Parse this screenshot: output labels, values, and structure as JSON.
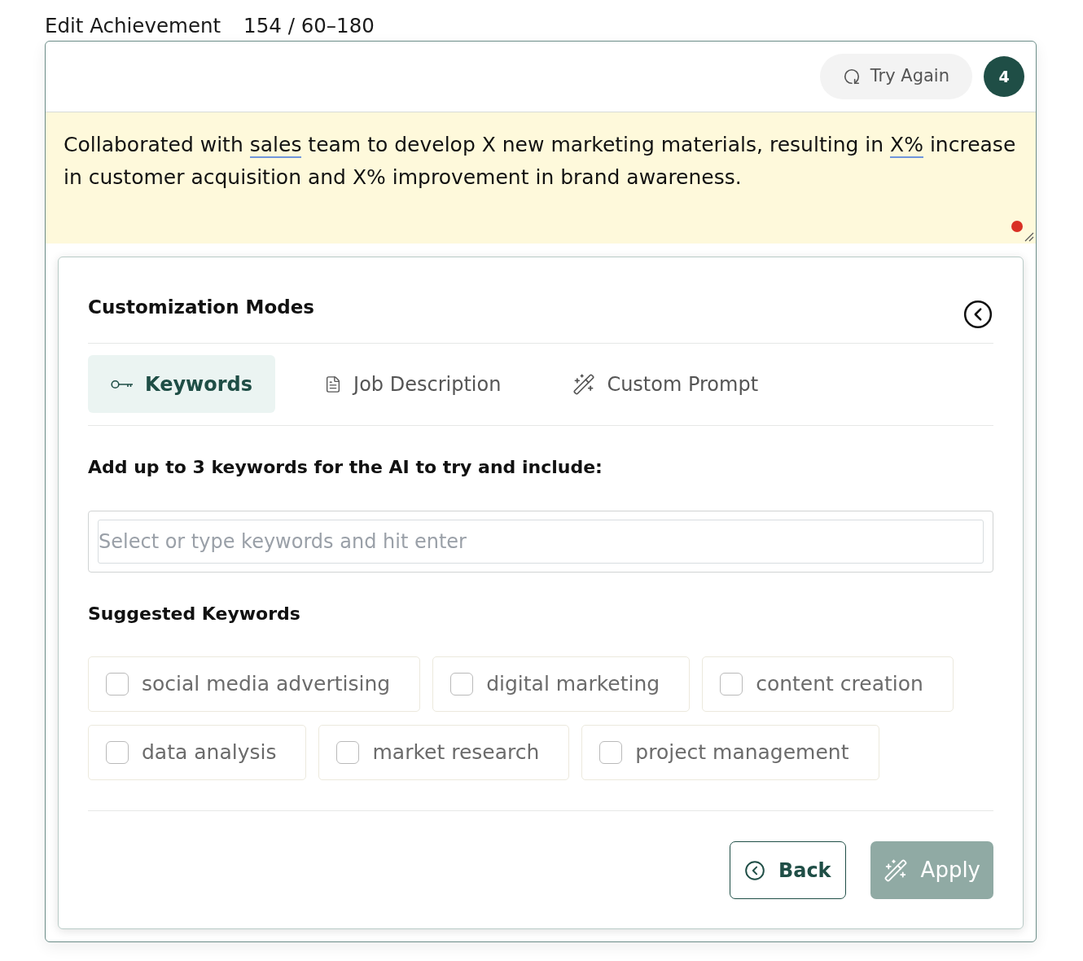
{
  "header": {
    "title": "Edit Achievement",
    "count": "154 / 60–180"
  },
  "toolbar": {
    "try_again": "Try Again",
    "badge": "4"
  },
  "achievement": {
    "segments": [
      {
        "text": "Collaborated with ",
        "underlined": false
      },
      {
        "text": "sales",
        "underlined": true
      },
      {
        "text": " team to develop X new marketing materials, resulting in ",
        "underlined": false
      },
      {
        "text": "X%",
        "underlined": true
      },
      {
        "text": " increase in customer acquisition and X% improvement in brand awareness.",
        "underlined": false
      }
    ],
    "flagged": true
  },
  "panel": {
    "title": "Customization Modes",
    "tabs": [
      {
        "label": "Keywords",
        "selected": true
      },
      {
        "label": "Job Description",
        "selected": false
      },
      {
        "label": "Custom Prompt",
        "selected": false
      }
    ],
    "keywords": {
      "instruction": "Add up to 3 keywords for the AI to try and include:",
      "input": {
        "placeholder": "Select or type keywords and hit enter"
      },
      "suggested_title": "Suggested Keywords",
      "suggested": [
        {
          "label": "social media advertising",
          "checked": false
        },
        {
          "label": "digital marketing",
          "checked": false
        },
        {
          "label": "content creation",
          "checked": false
        },
        {
          "label": "data analysis",
          "checked": false
        },
        {
          "label": "market research",
          "checked": false
        },
        {
          "label": "project management",
          "checked": false
        }
      ]
    },
    "actions": {
      "back": {
        "label": "Back"
      },
      "apply": {
        "label": "Apply",
        "disabled": true
      }
    }
  }
}
